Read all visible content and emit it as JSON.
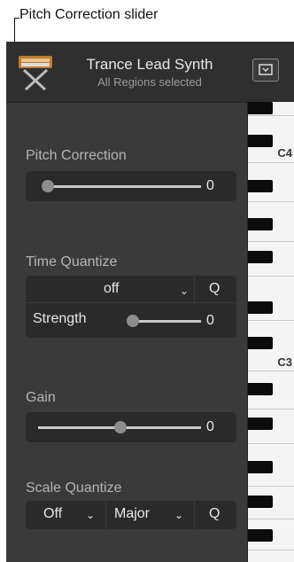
{
  "callout": {
    "label": "Pitch Correction slider"
  },
  "header": {
    "title": "Trance Lead Synth",
    "subtitle": "All Regions selected"
  },
  "pitch_correction": {
    "label": "Pitch Correction",
    "value": "0",
    "level": 0.0
  },
  "time_quantize": {
    "label": "Time Quantize",
    "selected": "off",
    "q_label": "Q",
    "strength_label": "Strength",
    "strength_value": "0",
    "strength_level": 0.0
  },
  "gain": {
    "label": "Gain",
    "value": "0",
    "level": 0.5
  },
  "scale_quantize": {
    "label": "Scale Quantize",
    "root_selected": "Off",
    "scale_selected": "Major",
    "q_label": "Q"
  },
  "piano": {
    "labels": [
      "C4",
      "C3"
    ]
  },
  "icons": [
    "synth-icon",
    "menu-icon",
    "chevron-down-icon"
  ]
}
